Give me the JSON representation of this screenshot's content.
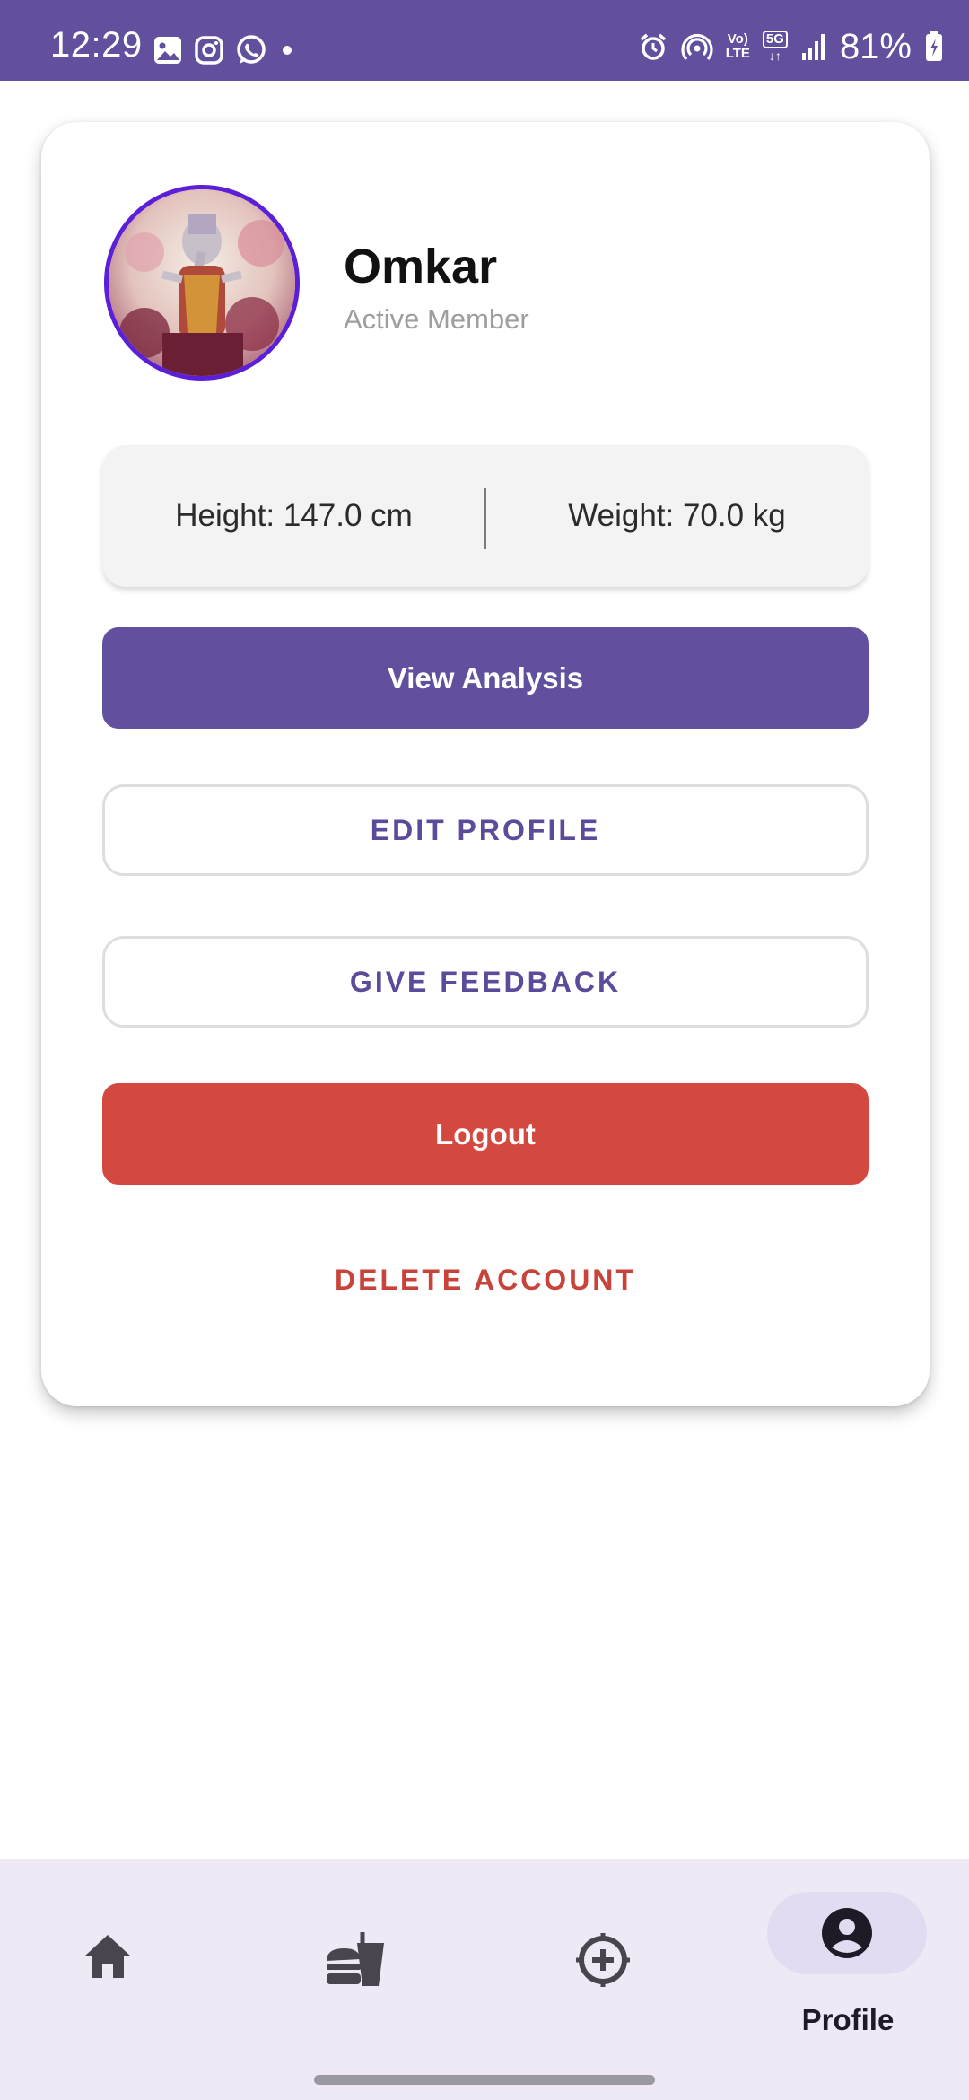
{
  "status_bar": {
    "time": "12:29",
    "battery": "81%",
    "network_badge": "5G",
    "volte_top": "Vo)",
    "volte_bottom": "LTE",
    "left_icons": [
      "gallery-icon",
      "instagram-icon",
      "whatsapp-icon",
      "dot-icon"
    ],
    "right_icons": [
      "alarm-icon",
      "hotspot-icon",
      "volte-icon",
      "5g-icon",
      "signal-icon",
      "battery-charging-icon"
    ]
  },
  "profile": {
    "name": "Omkar",
    "status": "Active Member",
    "avatar_icon": "avatar-photo"
  },
  "stats": {
    "height": "Height: 147.0 cm",
    "weight": "Weight: 70.0 kg"
  },
  "actions": {
    "view_analysis": "View Analysis",
    "edit_profile": "EDIT PROFILE",
    "give_feedback": "GIVE FEEDBACK",
    "logout": "Logout",
    "delete_account": "DELETE ACCOUNT"
  },
  "bottom_nav": {
    "items": [
      {
        "icon": "home-icon",
        "label": ""
      },
      {
        "icon": "food-icon",
        "label": ""
      },
      {
        "icon": "goal-icon",
        "label": ""
      },
      {
        "icon": "profile-icon",
        "label": "Profile",
        "active": true
      }
    ]
  },
  "colors": {
    "primary": "#62509e",
    "danger": "#d4493f",
    "nav_background": "#efe9f5",
    "avatar_border": "#5a1fd6"
  }
}
